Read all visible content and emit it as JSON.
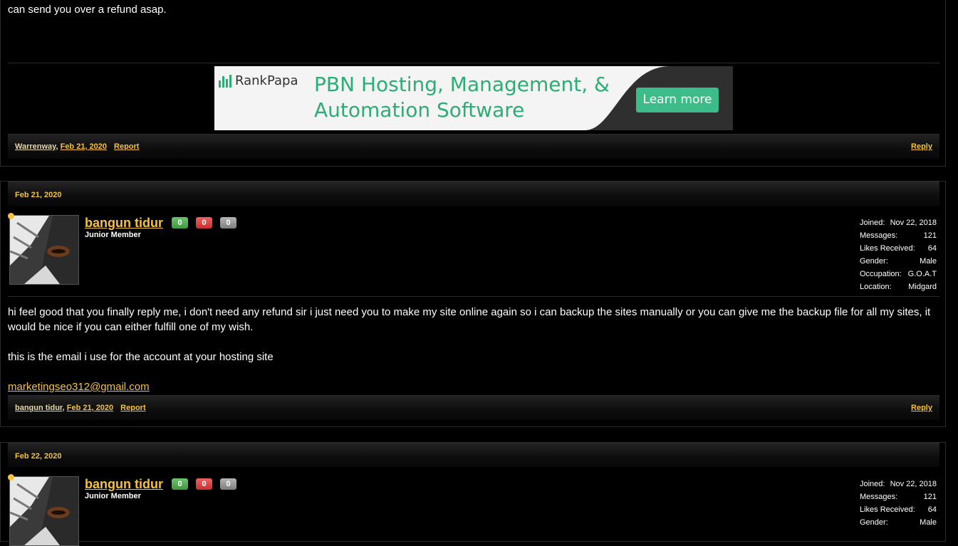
{
  "post_top": {
    "text": "can send you over a refund asap.",
    "ad": {
      "brand": "RankPapa",
      "headline": "PBN Hosting, Management, & Automation Software",
      "button": "Learn more"
    },
    "footer": {
      "user": "Warrenway",
      "date": "Feb 21, 2020",
      "report": "Report",
      "reply": "Reply"
    }
  },
  "posts": [
    {
      "date": "Feb 21, 2020",
      "username": "bangun tidur",
      "user_title": "Junior Member",
      "rep": {
        "positive": "0",
        "negative": "0",
        "neutral": "0"
      },
      "stats": [
        {
          "label": "Joined:",
          "value": "Nov 22, 2018"
        },
        {
          "label": "Messages:",
          "value": "121"
        },
        {
          "label": "Likes Received:",
          "value": "64"
        },
        {
          "label": "Gender:",
          "value": "Male"
        },
        {
          "label": "Occupation:",
          "value": "G.O.A.T"
        },
        {
          "label": "Location:",
          "value": "Midgard"
        }
      ],
      "body_p1": "hi feel good that you finally reply me, i don't need any refund sir i just need you to make my site online again so i can backup the sites manually or you can give me the backup file for all my sites, it would be nice if you can either fulfill one of my wish.",
      "body_p2": "this is the email i use for the account at your hosting site",
      "email": "marketingseo312@gmail.com",
      "footer": {
        "user": "bangun tidur",
        "date": "Feb 21, 2020",
        "report": "Report",
        "reply": "Reply"
      }
    },
    {
      "date": "Feb 22, 2020",
      "username": "bangun tidur",
      "user_title": "Junior Member",
      "rep": {
        "positive": "0",
        "negative": "0",
        "neutral": "0"
      },
      "stats": [
        {
          "label": "Joined:",
          "value": "Nov 22, 2018"
        },
        {
          "label": "Messages:",
          "value": "121"
        },
        {
          "label": "Likes Received:",
          "value": "64"
        },
        {
          "label": "Gender:",
          "value": "Male"
        }
      ]
    }
  ]
}
